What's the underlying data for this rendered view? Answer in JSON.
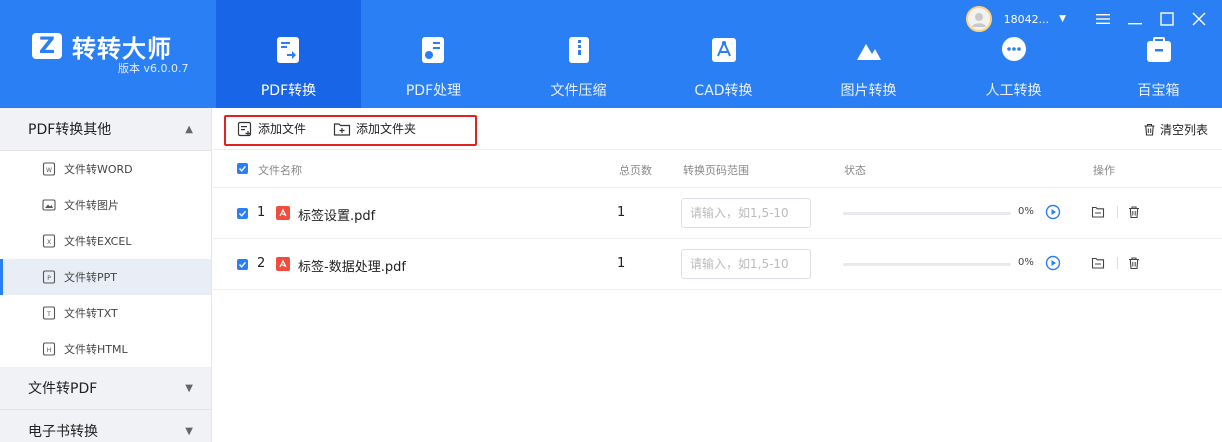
{
  "app": {
    "name": "转转大师",
    "version": "版本 v6.0.0.7",
    "user": "18042...",
    "colors": {
      "primary": "#2a7ff5",
      "active_tab": "#1865e8",
      "pdf_red": "#f24c3d",
      "highlight_border": "#e02222"
    }
  },
  "tabs": [
    {
      "label": "PDF转换",
      "icon": "pdf-convert-icon",
      "active": true
    },
    {
      "label": "PDF处理",
      "icon": "pdf-process-icon",
      "active": false
    },
    {
      "label": "文件压缩",
      "icon": "zip-icon",
      "active": false
    },
    {
      "label": "CAD转换",
      "icon": "cad-icon",
      "active": false
    },
    {
      "label": "图片转换",
      "icon": "image-icon",
      "active": false
    },
    {
      "label": "人工转换",
      "icon": "chat-icon",
      "active": false
    },
    {
      "label": "百宝箱",
      "icon": "toolbox-icon",
      "active": false
    }
  ],
  "sidebar": {
    "groups": [
      {
        "label": "PDF转换其他",
        "expanded": true,
        "items": [
          {
            "label": "文件转WORD",
            "icon": "word-icon",
            "letter": "W"
          },
          {
            "label": "文件转图片",
            "icon": "image-file-icon",
            "letter": ""
          },
          {
            "label": "文件转EXCEL",
            "icon": "excel-icon",
            "letter": "X"
          },
          {
            "label": "文件转PPT",
            "icon": "ppt-icon",
            "letter": "P"
          },
          {
            "label": "文件转TXT",
            "icon": "txt-icon",
            "letter": "T"
          },
          {
            "label": "文件转HTML",
            "icon": "html-icon",
            "letter": "H"
          }
        ]
      },
      {
        "label": "文件转PDF",
        "expanded": false
      },
      {
        "label": "电子书转换",
        "expanded": false
      }
    ]
  },
  "toolbar": {
    "add_file": "添加文件",
    "add_folder": "添加文件夹",
    "clear_list": "清空列表"
  },
  "table": {
    "headers": {
      "name": "文件名称",
      "pages": "总页数",
      "range": "转换页码范围",
      "status": "状态",
      "actions": "操作"
    },
    "rows": [
      {
        "index": "1",
        "name": "标签设置.pdf",
        "pages": "1",
        "range_placeholder": "请输入，如1,5-10",
        "progress": "0%"
      },
      {
        "index": "2",
        "name": "标签-数据处理.pdf",
        "pages": "1",
        "range_placeholder": "请输入，如1,5-10",
        "progress": "0%"
      }
    ]
  }
}
